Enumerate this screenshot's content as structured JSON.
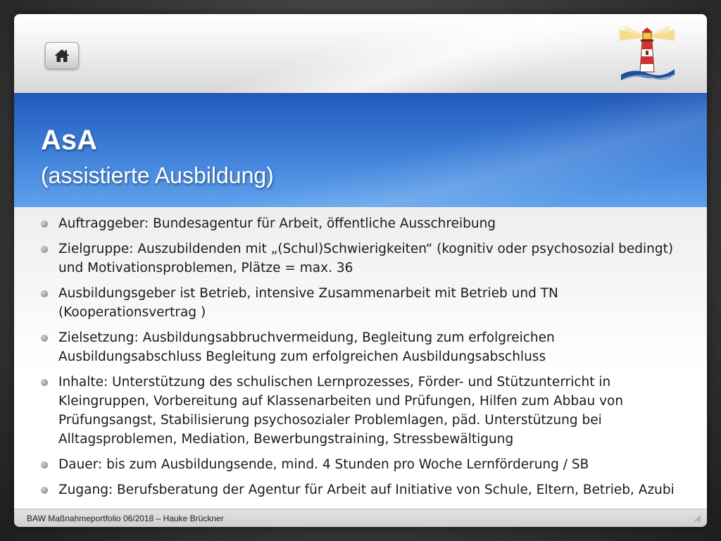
{
  "title": {
    "main": "AsA",
    "sub": "(assistierte Ausbildung)"
  },
  "bullets": [
    "Auftraggeber: Bundesagentur für Arbeit, öffentliche Ausschreibung",
    "Zielgruppe: Auszubildenden mit „(Schul)Schwierigkeiten“ (kognitiv oder psychosozial bedingt) und Motivationsproblemen, Plätze = max. 36",
    "Ausbildungsgeber ist Betrieb, intensive Zusammenarbeit mit Betrieb und TN (Kooperationsvertrag )",
    "Zielsetzung: Ausbildungsabbruchvermeidung, Begleitung zum erfolgreichen Ausbildungsabschluss Begleitung zum erfolgreichen Ausbildungsabschluss",
    "Inhalte: Unterstützung des schulischen Lernprozesses, Förder- und Stützunterricht in Kleingruppen, Vorbereitung auf Klassenarbeiten und Prüfungen, Hilfen zum Abbau von Prüfungsangst, Stabilisierung psychosozialer Problemlagen, päd. Unterstützung bei Alltagsproblemen, Mediation, Bewerbungstraining, Stressbewältigung",
    "Dauer: bis zum Ausbildungsende, mind. 4  Stunden pro Woche Lernförderung / SB",
    "Zugang: Berufsberatung der Agentur für Arbeit auf Initiative von Schule, Eltern, Betrieb, Azubi"
  ],
  "footer": {
    "text": "BAW Maßnahmeportfolio 06/2018 – Hauke Brückner"
  },
  "icons": {
    "home": "home-icon",
    "logo": "lighthouse-logo-icon",
    "resize": "resize-grip-icon"
  },
  "colors": {
    "title_band": "#3a7bd6",
    "title_text": "#ffffff",
    "body_text": "#1a1a1a",
    "bullet": "#9c9c9c"
  }
}
